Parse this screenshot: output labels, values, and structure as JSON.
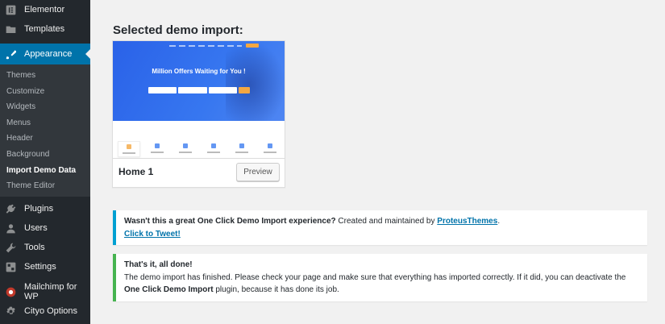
{
  "sidebar": {
    "items_top": [
      {
        "label": "Elementor",
        "icon": "elementor-icon"
      },
      {
        "label": "Templates",
        "icon": "folder-icon"
      }
    ],
    "active": {
      "label": "Appearance",
      "icon": "paintbrush-icon"
    },
    "submenu": [
      {
        "label": "Themes"
      },
      {
        "label": "Customize"
      },
      {
        "label": "Widgets"
      },
      {
        "label": "Menus"
      },
      {
        "label": "Header"
      },
      {
        "label": "Background"
      },
      {
        "label": "Import Demo Data",
        "current": true
      },
      {
        "label": "Theme Editor"
      }
    ],
    "items_bottom": [
      {
        "label": "Plugins",
        "icon": "plug-icon"
      },
      {
        "label": "Users",
        "icon": "user-icon"
      },
      {
        "label": "Tools",
        "icon": "wrench-icon"
      },
      {
        "label": "Settings",
        "icon": "settings-icon"
      },
      {
        "label": "Mailchimp for WP",
        "icon": "mailchimp-icon"
      },
      {
        "label": "Cityo Options",
        "icon": "gear-icon"
      }
    ]
  },
  "main": {
    "heading": "Selected demo import:",
    "demo": {
      "name": "Home 1",
      "preview_label": "Preview",
      "screenshot": {
        "hero_title": "Million Offers Waiting for You !"
      }
    },
    "notice_info": {
      "question": "Wasn't this a great One Click Demo Import experience?",
      "text": " Created and maintained by ",
      "author_link": "ProteusThemes",
      "period": ".",
      "tweet_link": "Click to Tweet!"
    },
    "notice_success": {
      "title": "That's it, all done!",
      "line1": "The demo import has finished. Please check your page and make sure that everything has imported correctly. If it did, you can deactivate the",
      "plugin_name": "One Click Demo Import",
      "line2": " plugin, because it has done its job."
    }
  },
  "colors": {
    "sidebar_bg": "#23282d",
    "accent": "#0073aa",
    "info_border": "#00a0d2",
    "success_border": "#46b450"
  }
}
